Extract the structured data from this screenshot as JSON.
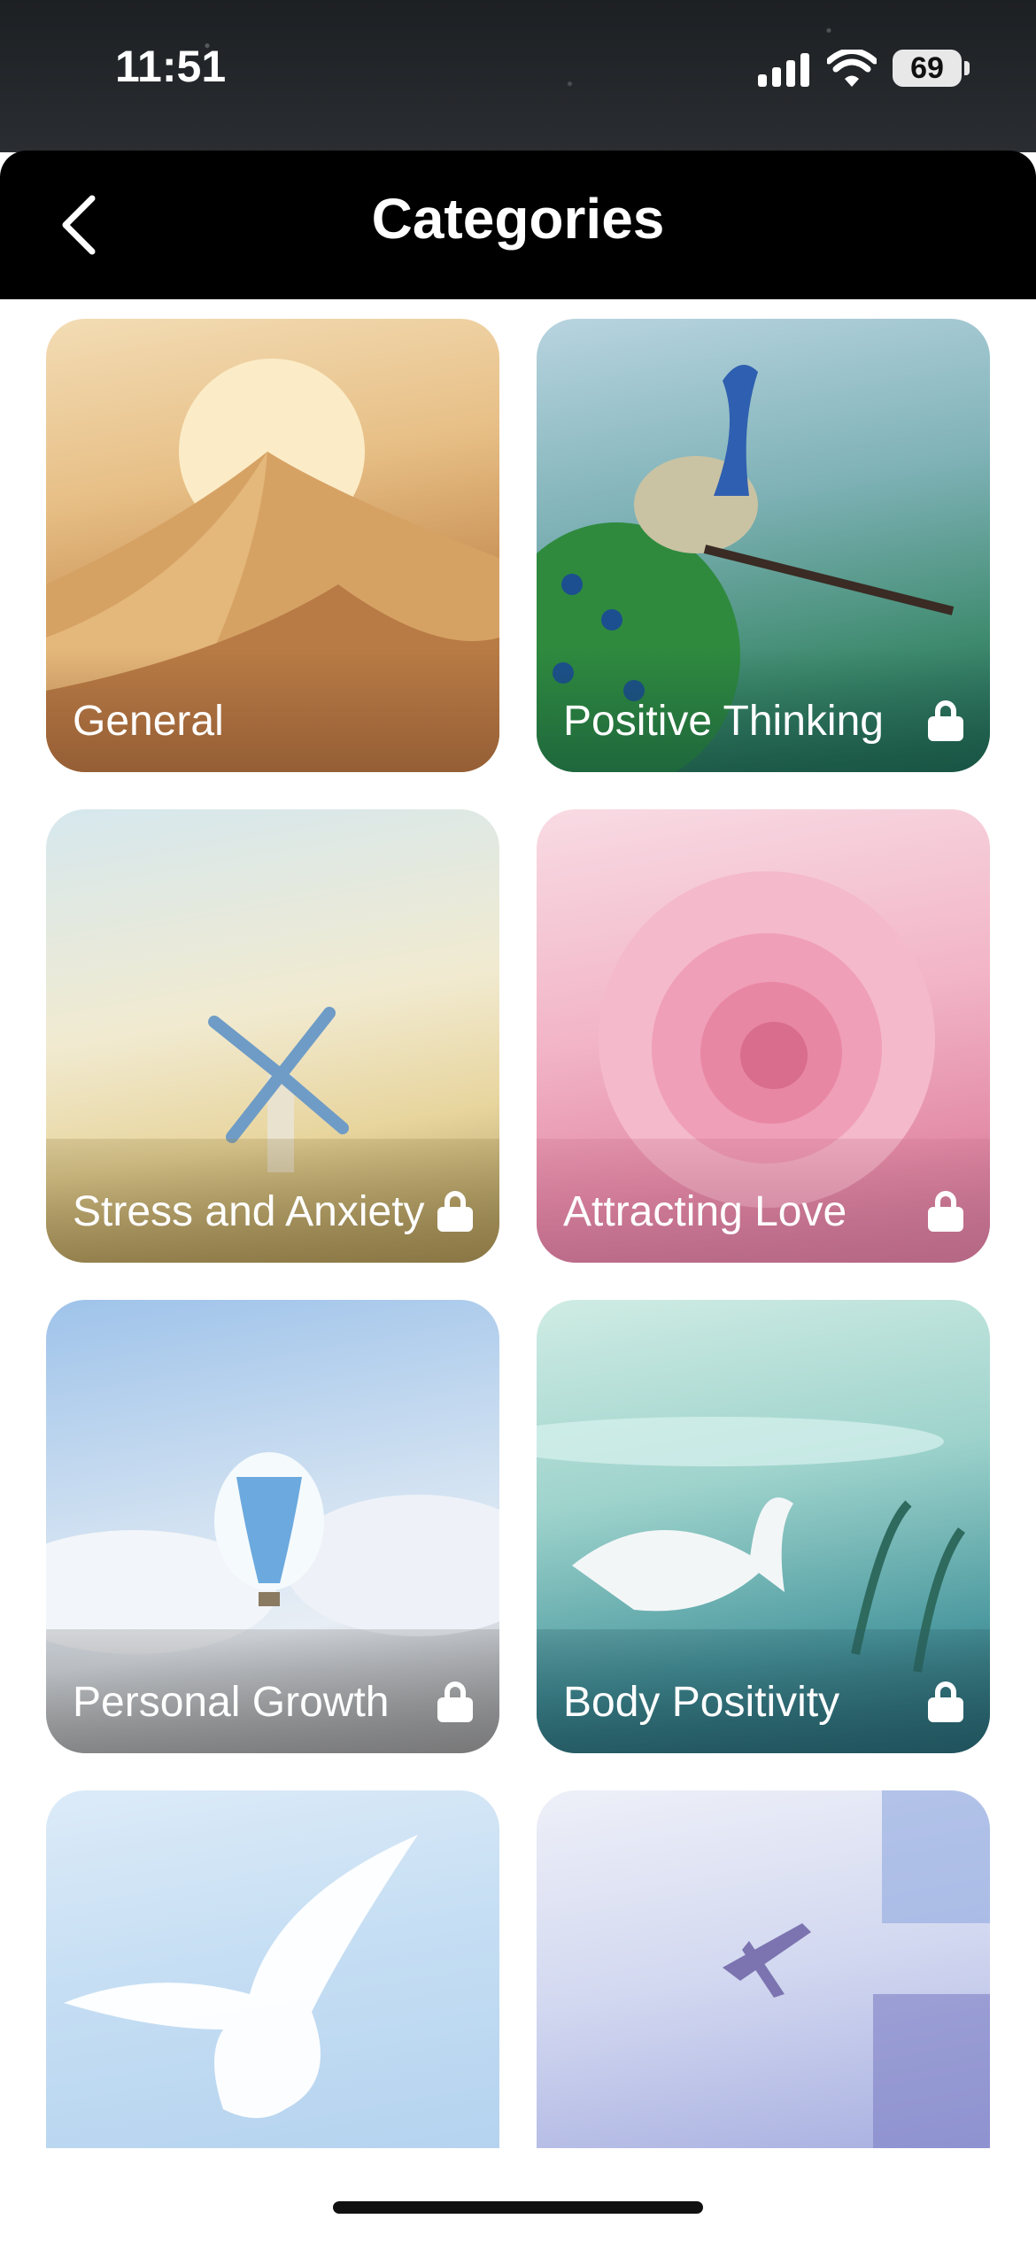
{
  "status_bar": {
    "time": "11:51",
    "battery": "69"
  },
  "header": {
    "title": "Categories",
    "back_icon": "chevron-left-icon"
  },
  "categories": [
    {
      "label": "General",
      "locked": false
    },
    {
      "label": "Positive Thinking",
      "locked": true
    },
    {
      "label": "Stress and Anxiety",
      "locked": true
    },
    {
      "label": "Attracting Love",
      "locked": true
    },
    {
      "label": "Personal Growth",
      "locked": true
    },
    {
      "label": "Body Positivity",
      "locked": true
    },
    {
      "label": "",
      "locked": false
    },
    {
      "label": "",
      "locked": false
    }
  ]
}
